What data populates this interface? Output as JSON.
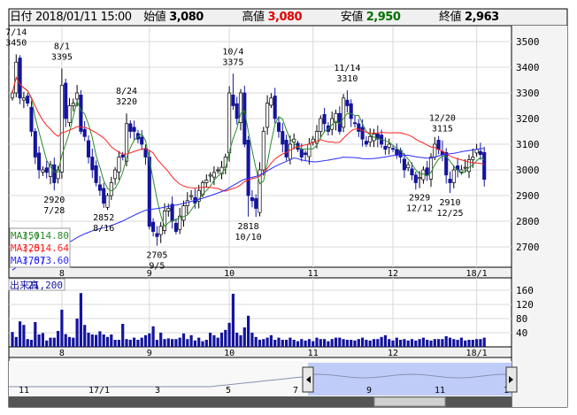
{
  "header": {
    "date_label": "日付",
    "date": "2018/01/11 15:00",
    "open_label": "始値",
    "open": "3,080",
    "high_label": "高値",
    "high": "3,080",
    "low_label": "安値",
    "low": "2,950",
    "close_label": "終値",
    "close": "2,963"
  },
  "colors": {
    "up": "#ffffff",
    "down": "#14149c",
    "ma5": "#2a8a2a",
    "ma25": "#ff2020",
    "ma75": "#2a2aff",
    "high": "#e00000",
    "low": "#007000",
    "volume": "#14149c",
    "nav_fill": "#c0ccf8"
  },
  "legend": [
    {
      "name": "MA(5)",
      "value": "3,014.80"
    },
    {
      "name": "MA(25)",
      "value": "3,014.64"
    },
    {
      "name": "MA(75)",
      "value": "3,073.60"
    }
  ],
  "volume_label": {
    "name": "出来高",
    "value": "21,200"
  },
  "chart_data": {
    "type": "candlestick",
    "price_ticks": [
      2700,
      2800,
      2900,
      3000,
      3100,
      3200,
      3300,
      3400,
      3500
    ],
    "price_ylim": [
      2640,
      3520
    ],
    "volume_ticks": [
      40,
      80,
      120,
      160
    ],
    "volume_ylim": [
      0,
      170
    ],
    "month_ticks": [
      {
        "label": "8",
        "index": 13
      },
      {
        "label": "9",
        "index": 36
      },
      {
        "label": "10",
        "index": 57
      },
      {
        "label": "11",
        "index": 79
      },
      {
        "label": "12",
        "index": 100
      },
      {
        "label": "18/1",
        "index": 122
      }
    ],
    "close": [
      3300,
      3420,
      3280,
      3280,
      3260,
      3150,
      3050,
      3000,
      3000,
      2990,
      3020,
      2950,
      3000,
      3330,
      3200,
      3250,
      3260,
      3300,
      3150,
      3130,
      3050,
      3000,
      2950,
      2920,
      2870,
      2900,
      2950,
      3000,
      3050,
      3050,
      3180,
      3150,
      3150,
      3120,
      3100,
      3050,
      2780,
      2760,
      2740,
      2780,
      2840,
      2850,
      2800,
      2760,
      2820,
      2860,
      2880,
      2900,
      2870,
      2920,
      2950,
      2960,
      2980,
      2990,
      3000,
      3010,
      3050,
      3300,
      3250,
      3200,
      3300,
      3100,
      2900,
      2880,
      2850,
      3000,
      3150,
      3260,
      3280,
      3200,
      3150,
      3100,
      3050,
      3100,
      3120,
      3080,
      3050,
      3060,
      3100,
      3120,
      3150,
      3200,
      3180,
      3150,
      3200,
      3220,
      3150,
      3280,
      3250,
      3200,
      3180,
      3150,
      3120,
      3100,
      3130,
      3140,
      3120,
      3100,
      3080,
      3100,
      3080,
      3060,
      3050,
      3000,
      3020,
      2980,
      2950,
      2970,
      3000,
      2980,
      3050,
      3100,
      3080,
      3060,
      2980,
      2950,
      3000,
      3000,
      3000,
      3010,
      3040,
      3050,
      3080,
      3060,
      2963
    ],
    "volume": [
      42,
      28,
      72,
      62,
      22,
      20,
      70,
      35,
      39,
      18,
      26,
      26,
      45,
      105,
      36,
      28,
      26,
      80,
      152,
      62,
      40,
      35,
      34,
      44,
      35,
      28,
      35,
      20,
      20,
      65,
      22,
      20,
      26,
      20,
      26,
      33,
      38,
      58,
      20,
      40,
      22,
      24,
      22,
      22,
      26,
      38,
      22,
      33,
      18,
      26,
      16,
      20,
      40,
      33,
      26,
      40,
      48,
      68,
      150,
      40,
      33,
      55,
      88,
      40,
      28,
      20,
      22,
      26,
      33,
      20,
      26,
      20,
      20,
      26,
      20,
      16,
      22,
      18,
      22,
      16,
      26,
      22,
      22,
      16,
      22,
      26,
      26,
      22,
      20,
      20,
      18,
      22,
      26,
      20,
      18,
      22,
      22,
      28,
      33,
      22,
      18,
      26,
      20,
      22,
      18,
      22,
      18,
      22,
      26,
      20,
      18,
      22,
      22,
      22,
      30,
      26,
      22,
      20,
      26,
      18,
      20,
      20,
      22,
      22,
      26
    ],
    "annotations": [
      {
        "date": "7/14",
        "value": 3450,
        "index": 1,
        "kind": "high"
      },
      {
        "date": "7/28",
        "value": 2920,
        "index": 11,
        "kind": "low"
      },
      {
        "date": "8/1",
        "value": 3395,
        "index": 13,
        "kind": "high"
      },
      {
        "date": "8/16",
        "value": 2852,
        "index": 24,
        "kind": "low"
      },
      {
        "date": "8/24",
        "value": 3220,
        "index": 30,
        "kind": "high"
      },
      {
        "date": "9/5",
        "value": 2705,
        "index": 38,
        "kind": "low"
      },
      {
        "date": "10/4",
        "value": 3375,
        "index": 58,
        "kind": "high"
      },
      {
        "date": "10/10",
        "value": 2818,
        "index": 62,
        "kind": "low"
      },
      {
        "date": "11/14",
        "value": 3310,
        "index": 88,
        "kind": "high"
      },
      {
        "date": "12/12",
        "value": 2929,
        "index": 107,
        "kind": "low"
      },
      {
        "date": "12/20",
        "value": 3115,
        "index": 113,
        "kind": "high"
      },
      {
        "date": "12/25",
        "value": 2910,
        "index": 115,
        "kind": "low"
      }
    ]
  },
  "navigator": {
    "labels": [
      "11",
      "17/1",
      "3",
      "5",
      "7",
      "9",
      "11",
      "1"
    ]
  }
}
